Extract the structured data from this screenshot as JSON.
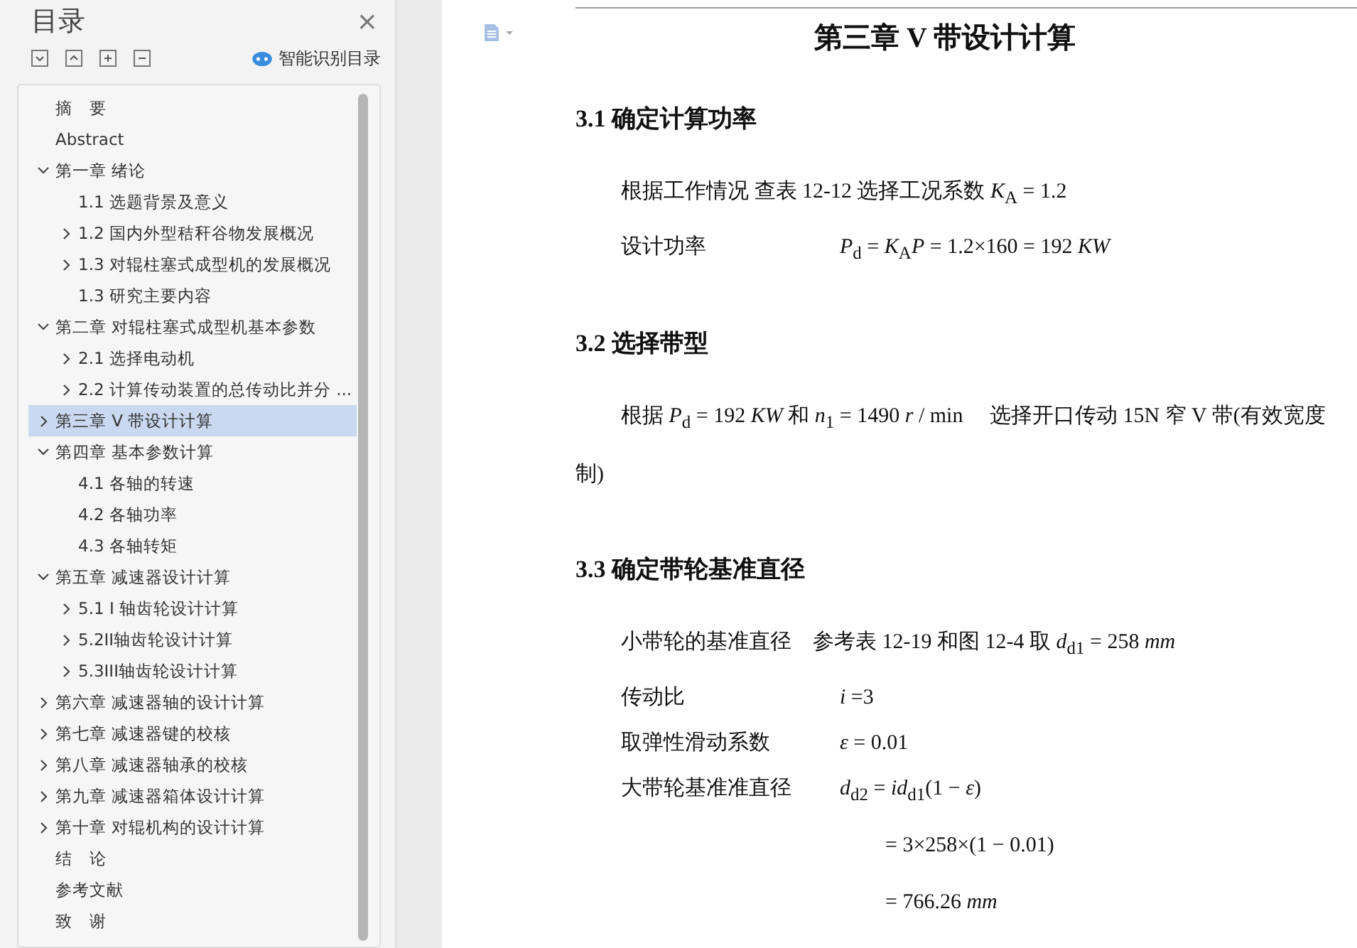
{
  "toc": {
    "title": "目录",
    "close": "×",
    "smart_link": "智能识别目录",
    "items": [
      {
        "label": "摘　要",
        "selected": false
      },
      {
        "label": "Abstract",
        "selected": false
      },
      {
        "label": "第一章  绪论",
        "selected": false,
        "expanded": true,
        "children": [
          {
            "label": "1.1 选题背景及意义",
            "selected": false
          },
          {
            "label": "1.2 国内外型秸秆谷物发展概况",
            "selected": false,
            "expanded": false
          },
          {
            "label": "1.3 对辊柱塞式成型机的发展概况",
            "selected": false,
            "expanded": false
          },
          {
            "label": "1.3 研究主要内容",
            "selected": false
          }
        ]
      },
      {
        "label": "第二章  对辊柱塞式成型机基本参数",
        "selected": false,
        "expanded": true,
        "children": [
          {
            "label": "2.1 选择电动机",
            "selected": false,
            "expanded": false
          },
          {
            "label": "2.2 计算传动装置的总传动比并分 ...",
            "selected": false,
            "expanded": false
          }
        ]
      },
      {
        "label": "第三章  V 带设计计算",
        "selected": true,
        "expanded": false
      },
      {
        "label": "第四章  基本参数计算",
        "selected": false,
        "expanded": true,
        "children": [
          {
            "label": "4.1 各轴的转速",
            "selected": false
          },
          {
            "label": "4.2 各轴功率",
            "selected": false
          },
          {
            "label": "4.3 各轴转矩",
            "selected": false
          }
        ]
      },
      {
        "label": "第五章  减速器设计计算",
        "selected": false,
        "expanded": true,
        "children": [
          {
            "label": "5.1 I 轴齿轮设计计算",
            "selected": false,
            "expanded": false
          },
          {
            "label": "5.2II轴齿轮设计计算",
            "selected": false,
            "expanded": false
          },
          {
            "label": "5.3III轴齿轮设计计算",
            "selected": false,
            "expanded": false
          }
        ]
      },
      {
        "label": "第六章  减速器轴的设计计算",
        "selected": false,
        "expanded": false
      },
      {
        "label": "第七章  减速器键的校核",
        "selected": false,
        "expanded": false
      },
      {
        "label": "第八章  减速器轴承的校核",
        "selected": false,
        "expanded": false
      },
      {
        "label": "第九章  减速器箱体设计计算",
        "selected": false,
        "expanded": false
      },
      {
        "label": "第十章  对辊机构的设计计算",
        "selected": false,
        "expanded": false
      },
      {
        "label": "结　论",
        "selected": false
      },
      {
        "label": "参考文献",
        "selected": false
      },
      {
        "label": "致　谢",
        "selected": false
      }
    ]
  },
  "document": {
    "title": "第三章  V 带设计计算",
    "sections": [
      {
        "heading": "3.1 确定计算功率",
        "lines": [
          {
            "kind": "para",
            "text": "根据工作情况  查表 12-12 选择工况系数 *K*$_{A}$ = 1.2"
          },
          {
            "kind": "row",
            "label": "设计功率",
            "formula": "*P*$_{d}$ = *K*$_{A}$*P* = 1.2×160 = 192 *KW*"
          }
        ]
      },
      {
        "heading": "3.2 选择带型",
        "lines": [
          {
            "kind": "para",
            "text": "根据 *P*$_{d}$ = 192 *KW* 和 *n*$_{1}$ = 1490 *r* / min　 选择开口传动 15N 窄 V 带(有效宽度制)"
          }
        ]
      },
      {
        "heading": "3.3 确定带轮基准直径",
        "lines": [
          {
            "kind": "para",
            "text": "小带轮的基准直径　参考表 12-19 和图 12-4 取  *d*$_{d1}$ = 258 *mm*"
          },
          {
            "kind": "row",
            "label": "传动比",
            "formula": "*i* =3"
          },
          {
            "kind": "row",
            "label": "取弹性滑动系数",
            "formula": "*ε* = 0.01"
          },
          {
            "kind": "row",
            "label": "大带轮基准准直径",
            "formula": "*d*$_{d2}$ = *id*$_{d1}$(1 − *ε*)"
          },
          {
            "kind": "cont",
            "formula": "= 3×258×(1 − 0.01)"
          },
          {
            "kind": "cont",
            "formula": "= 766.26 *mm*"
          }
        ]
      }
    ]
  }
}
